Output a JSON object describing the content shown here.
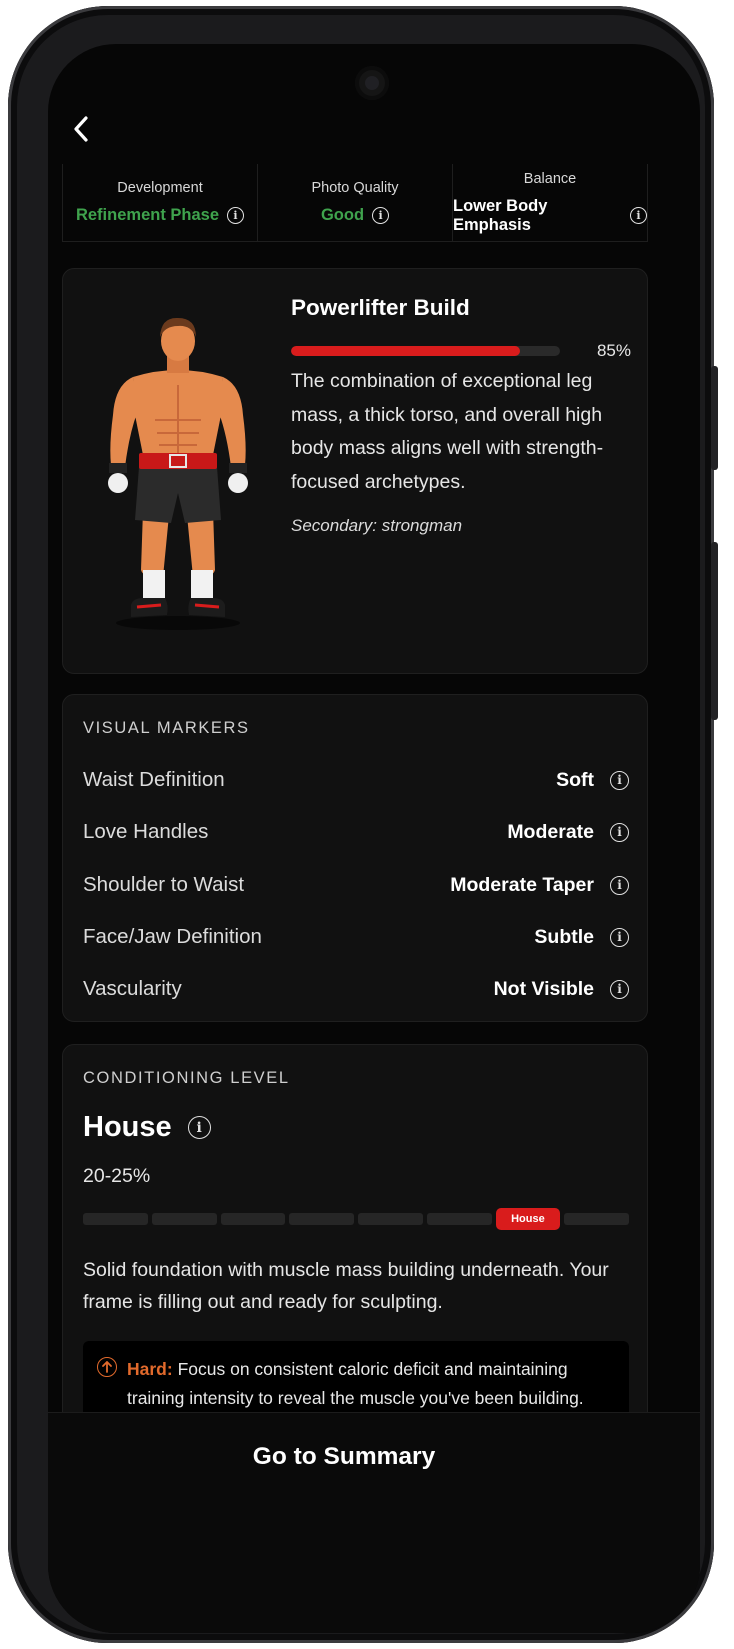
{
  "stats": [
    {
      "label": "Development",
      "value": "Refinement Phase",
      "color": "#3fa34d"
    },
    {
      "label": "Photo Quality",
      "value": "Good",
      "color": "#3fa34d"
    },
    {
      "label": "Balance",
      "value": "Lower Body Emphasis",
      "color": "#ffffff"
    }
  ],
  "build": {
    "title": "Powerlifter Build",
    "match_percent": 85,
    "match_label": "85%",
    "description": "The combination of exceptional leg mass, a thick torso, and overall high body mass aligns well with strength-focused archetypes.",
    "secondary": "Secondary: strongman"
  },
  "markers": {
    "title": "VISUAL MARKERS",
    "rows": [
      {
        "label": "Waist Definition",
        "value": "Soft"
      },
      {
        "label": "Love Handles",
        "value": "Moderate"
      },
      {
        "label": "Shoulder to Waist",
        "value": "Moderate Taper"
      },
      {
        "label": "Face/Jaw Definition",
        "value": "Subtle"
      },
      {
        "label": "Vascularity",
        "value": "Not Visible"
      }
    ]
  },
  "conditioning": {
    "title": "CONDITIONING LEVEL",
    "level": "House",
    "range": "20-25%",
    "segment_count": 8,
    "active_segment": 7,
    "active_badge": "House",
    "description": "Solid foundation with muscle mass building underneath. Your frame is filling out and ready for sculpting.",
    "warning_label": "Hard:",
    "warning_text": "Focus on consistent caloric deficit and maintaining training intensity to reveal the muscle you've been building."
  },
  "cta": {
    "label": "Go to Summary"
  },
  "colors": {
    "accent": "#d91c1c",
    "good": "#3fa34d",
    "warning": "#e26a2c"
  }
}
